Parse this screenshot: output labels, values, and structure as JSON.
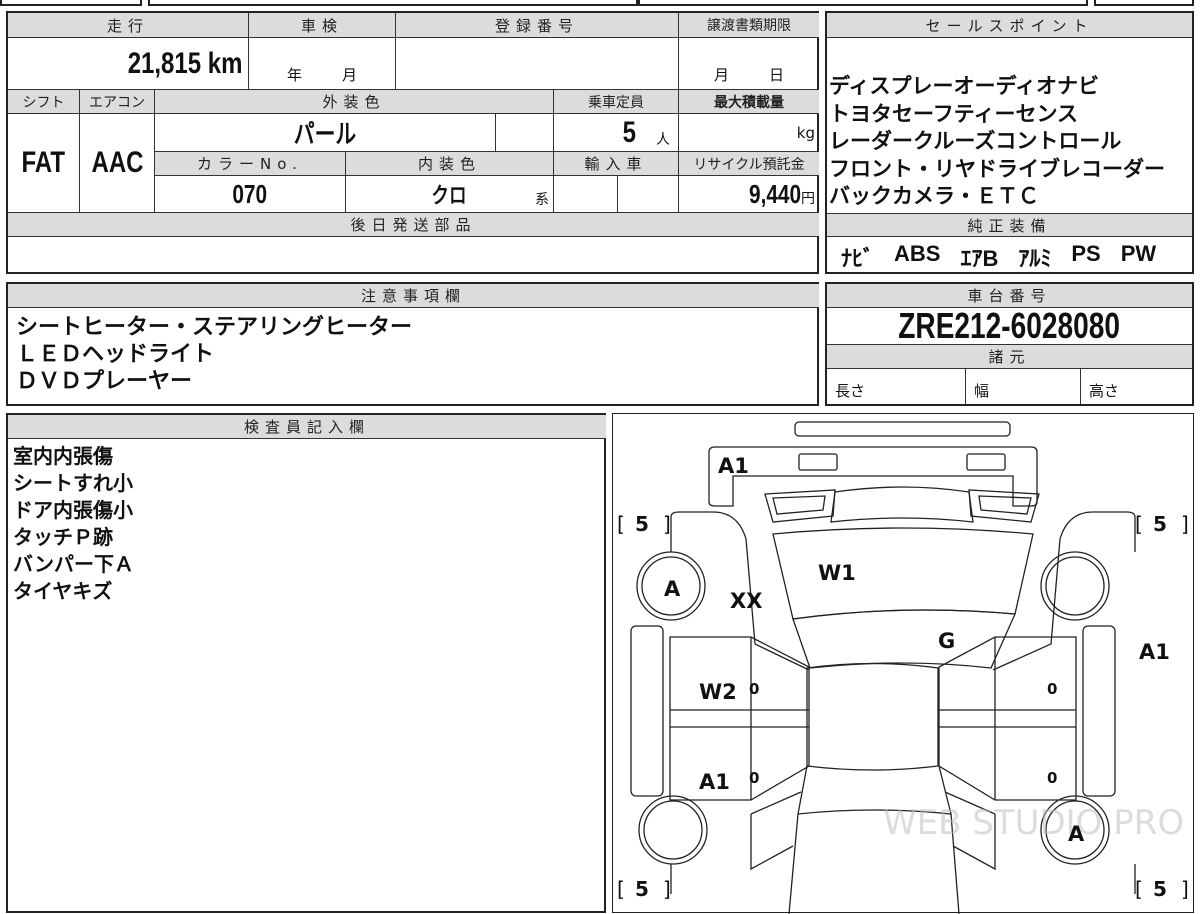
{
  "vehicle_info": {
    "mileage_label": "走行",
    "mileage_value": "21,815",
    "mileage_unit": "km",
    "inspection_label": "車検",
    "inspection_year_unit": "年",
    "inspection_month_unit": "月",
    "registration_label": "登録番号",
    "transfer_deadline_label": "譲渡書類期限",
    "transfer_month_unit": "月",
    "transfer_day_unit": "日",
    "shift_label": "シフト",
    "shift_value": "FAT",
    "aircon_label": "エアコン",
    "aircon_value": "AAC",
    "exterior_color_label": "外装色",
    "exterior_color_value": "パール",
    "capacity_label": "乗車定員",
    "capacity_value": "5",
    "capacity_unit": "人",
    "max_load_label": "最大積載量",
    "max_load_unit": "kg",
    "color_no_label": "カラーNo.",
    "color_no_value": "070",
    "interior_color_label": "内装色",
    "interior_color_value": "クロ",
    "interior_color_suffix": "系",
    "import_label": "輸入車",
    "recycle_label": "リサイクル預託金",
    "recycle_value": "9,440",
    "recycle_unit": "円",
    "later_parts_label": "後日発送部品"
  },
  "sales_points": {
    "label": "セールスポイント",
    "text": "ディスプレーオーディオナビ\nトヨタセーフティーセンス\nレーダークルーズコントロール\nフロント・リヤドライブレコーダー\nバックカメラ・ＥＴＣ",
    "equipment_label": "純正装備",
    "equipment": [
      "ﾅﾋﾞ",
      "ABS",
      "ｴｱB",
      "ｱﾙﾐ",
      "PS",
      "PW"
    ]
  },
  "notes": {
    "label": "注意事項欄",
    "text": "シートヒーター・ステアリングヒーター\nＬＥＤヘッドライト\nＤＶＤプレーヤー"
  },
  "chassis": {
    "label": "車台番号",
    "value": "ZRE212-6028080",
    "specs_label": "諸元",
    "length_label": "長さ",
    "width_label": "幅",
    "height_label": "高さ"
  },
  "inspector": {
    "label": "検査員記入欄",
    "text": "室内内張傷\nシートすれ小\nドア内張傷小\nタッチＰ跡\nバンパー下Ａ\nタイヤキズ"
  },
  "diagram": {
    "marks": {
      "front_bumper": "A1",
      "windshield": "W1",
      "front_left_fender": "XX",
      "hood_rear": "G",
      "right_side": "A1",
      "left_front_door": "W2",
      "left_rear_door": "A1",
      "front_left_wheel": "A",
      "rear_right_wheel": "A",
      "door_zero": "0"
    },
    "tire_tread": {
      "front_left": "5",
      "front_right": "5",
      "rear_left": "5",
      "rear_right": "5"
    },
    "bracket_open": "[",
    "bracket_close": "]",
    "watermark": "WEB STUDIO PRO"
  }
}
